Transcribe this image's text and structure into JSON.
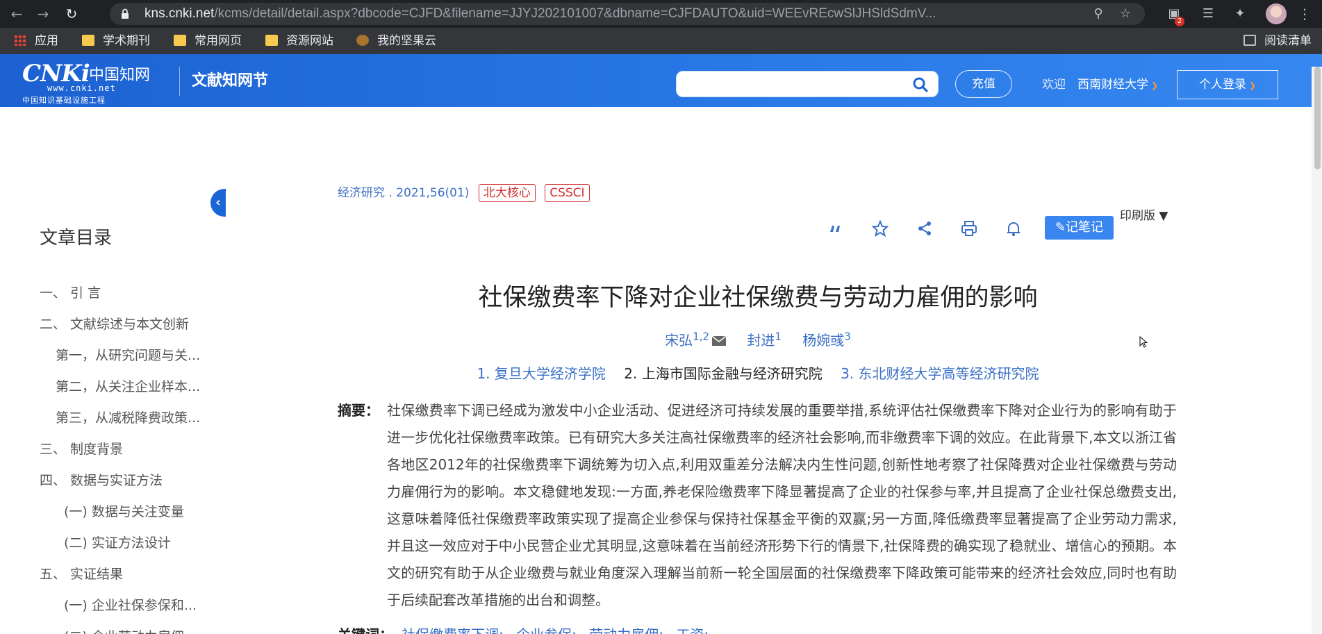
{
  "browser": {
    "url_host": "kns.cnki.net",
    "url_path": "/kcms/detail/detail.aspx?dbcode=CJFD&filename=JJYJ202101007&dbname=CJFDAUTO&uid=WEEvREcwSlJHSldSdmV...",
    "extension_badge": "2",
    "bookmarks": [
      "应用",
      "学术期刊",
      "常用网页",
      "资源网站",
      "我的坚果云"
    ],
    "reading_list": "阅读清单"
  },
  "site": {
    "logo_text": "CNKi",
    "logo_cn": "中国知网",
    "logo_url": "www.cnki.net",
    "logo_subtitle": "中国知识基础设施工程",
    "name": "文献知网节",
    "search_placeholder": "",
    "recharge": "充值",
    "welcome": "欢迎",
    "institution": "西南财经大学",
    "login": "个人登录"
  },
  "toc": {
    "title": "文章目录",
    "items": [
      "一、 引 言",
      "二、 文献综述与本文创新",
      "第一，从研究问题与关...",
      "第二，从关注企业样本...",
      "第三，从减税降费政策...",
      "三、 制度背景",
      "四、 数据与实证方法",
      "(一) 数据与关注变量",
      "(二) 实证方法设计",
      "五、 实证结果",
      "(一) 企业社保参保和...",
      "(二) 企业劳动力雇佣..."
    ]
  },
  "article": {
    "source": "经济研究 . 2021,56(01)",
    "tags": [
      "北大核心",
      "CSSCI"
    ],
    "notes_button": "记笔记",
    "print_version": "印刷版",
    "title": "社保缴费率下降对企业社保缴费与劳动力雇佣的影响",
    "authors": [
      {
        "name": "宋弘",
        "sup": "1,2"
      },
      {
        "name": "封进",
        "sup": "1"
      },
      {
        "name": "杨婉彧",
        "sup": "3"
      }
    ],
    "affiliations": [
      "1. 复旦大学经济学院",
      "2. 上海市国际金融与经济研究院",
      "3. 东北财经大学高等经济研究院"
    ],
    "abstract_label": "摘要：",
    "abstract": "社保缴费率下调已经成为激发中小企业活动、促进经济可持续发展的重要举措,系统评估社保缴费率下降对企业行为的影响有助于进一步优化社保缴费率政策。已有研究大多关注高社保缴费率的经济社会影响,而非缴费率下调的效应。在此背景下,本文以浙江省各地区2012年的社保缴费率下调统筹为切入点,利用双重差分法解决内生性问题,创新性地考察了社保降费对企业社保缴费与劳动力雇佣行为的影响。本文稳健地发现:一方面,养老保险缴费率下降显著提高了企业的社保参与率,并且提高了企业社保总缴费支出,这意味着降低社保缴费率政策实现了提高企业参保与保持社保基金平衡的双赢;另一方面,降低缴费率显著提高了企业劳动力需求,并且这一效应对于中小民营企业尤其明显,这意味着在当前经济形势下行的情景下,社保降费的确实现了稳就业、增信心的预期。本文的研究有助于从企业缴费与就业角度深入理解当前新一轮全国层面的社保缴费率下降政策可能带来的经济社会效应,同时也有助于后续配套改革措施的出台和调整。",
    "keywords_label": "关键词：",
    "keywords": [
      "社保缴费率下调;",
      "企业参保;",
      "劳动力雇佣;",
      "工资;"
    ]
  },
  "colors": {
    "header_blue": "#1a66d6",
    "link_blue": "#3a6fc6",
    "tag_red": "#d43030",
    "notes_blue": "#3a86ef"
  }
}
